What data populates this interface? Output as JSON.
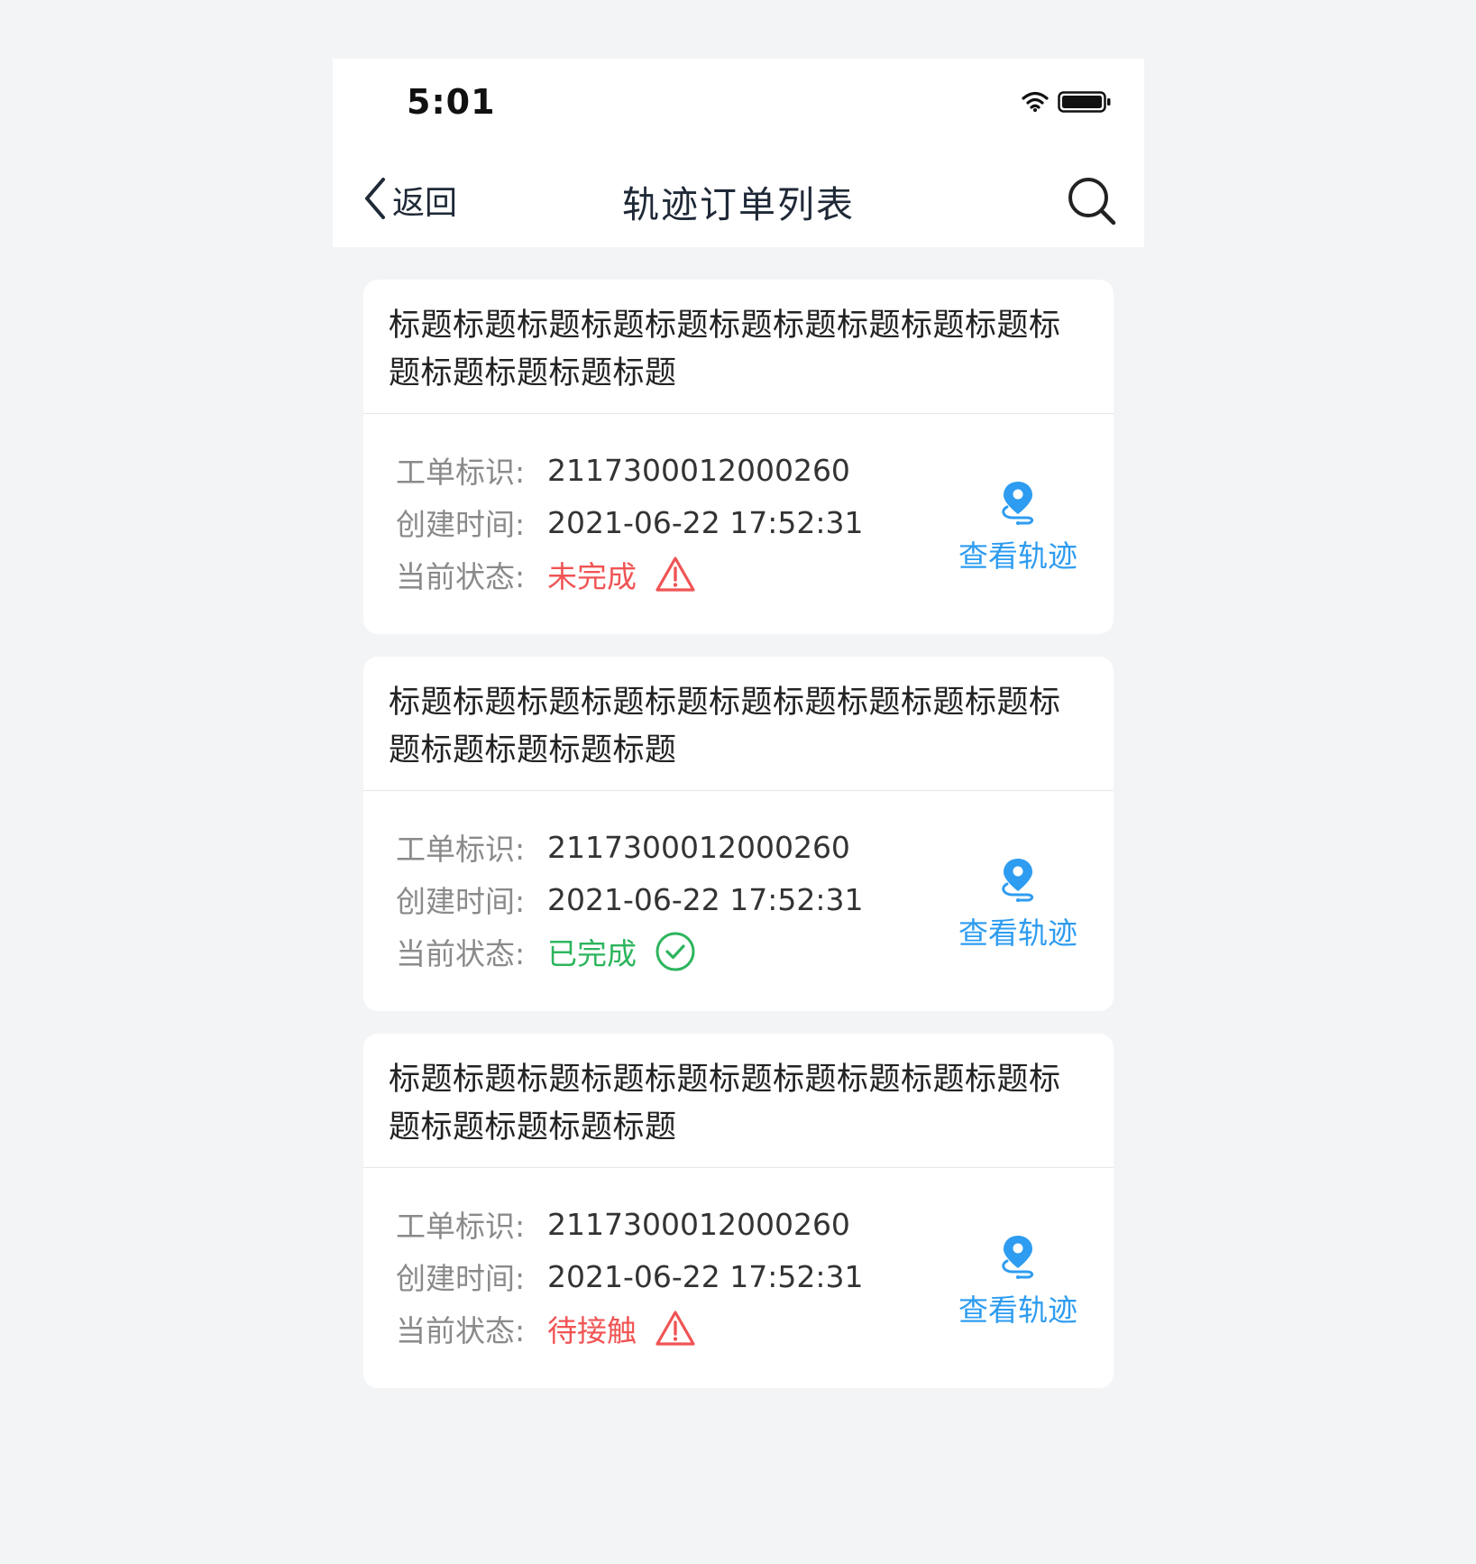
{
  "status_bar": {
    "time": "5:01"
  },
  "nav": {
    "back_label": "返回",
    "title": "轨迹订单列表"
  },
  "labels": {
    "order_id": "工单标识:",
    "created_time": "创建时间:",
    "current_status": "当前状态:",
    "view_track": "查看轨迹"
  },
  "colors": {
    "accent_blue": "#2e9cf0",
    "status_red": "#f05454",
    "status_green": "#2db55d"
  },
  "orders": [
    {
      "title": "标题标题标题标题标题标题标题标题标题标题标题标题标题标题标题",
      "order_id": "2117300012000260",
      "created_time": "2021-06-22 17:52:31",
      "status": "未完成",
      "status_icon": "warning-icon"
    },
    {
      "title": "标题标题标题标题标题标题标题标题标题标题标题标题标题标题标题",
      "order_id": "2117300012000260",
      "created_time": "2021-06-22 17:52:31",
      "status": "已完成",
      "status_icon": "check-circle-icon"
    },
    {
      "title": "标题标题标题标题标题标题标题标题标题标题标题标题标题标题标题",
      "order_id": "2117300012000260",
      "created_time": "2021-06-22 17:52:31",
      "status": "待接触",
      "status_icon": "warning-icon"
    }
  ]
}
